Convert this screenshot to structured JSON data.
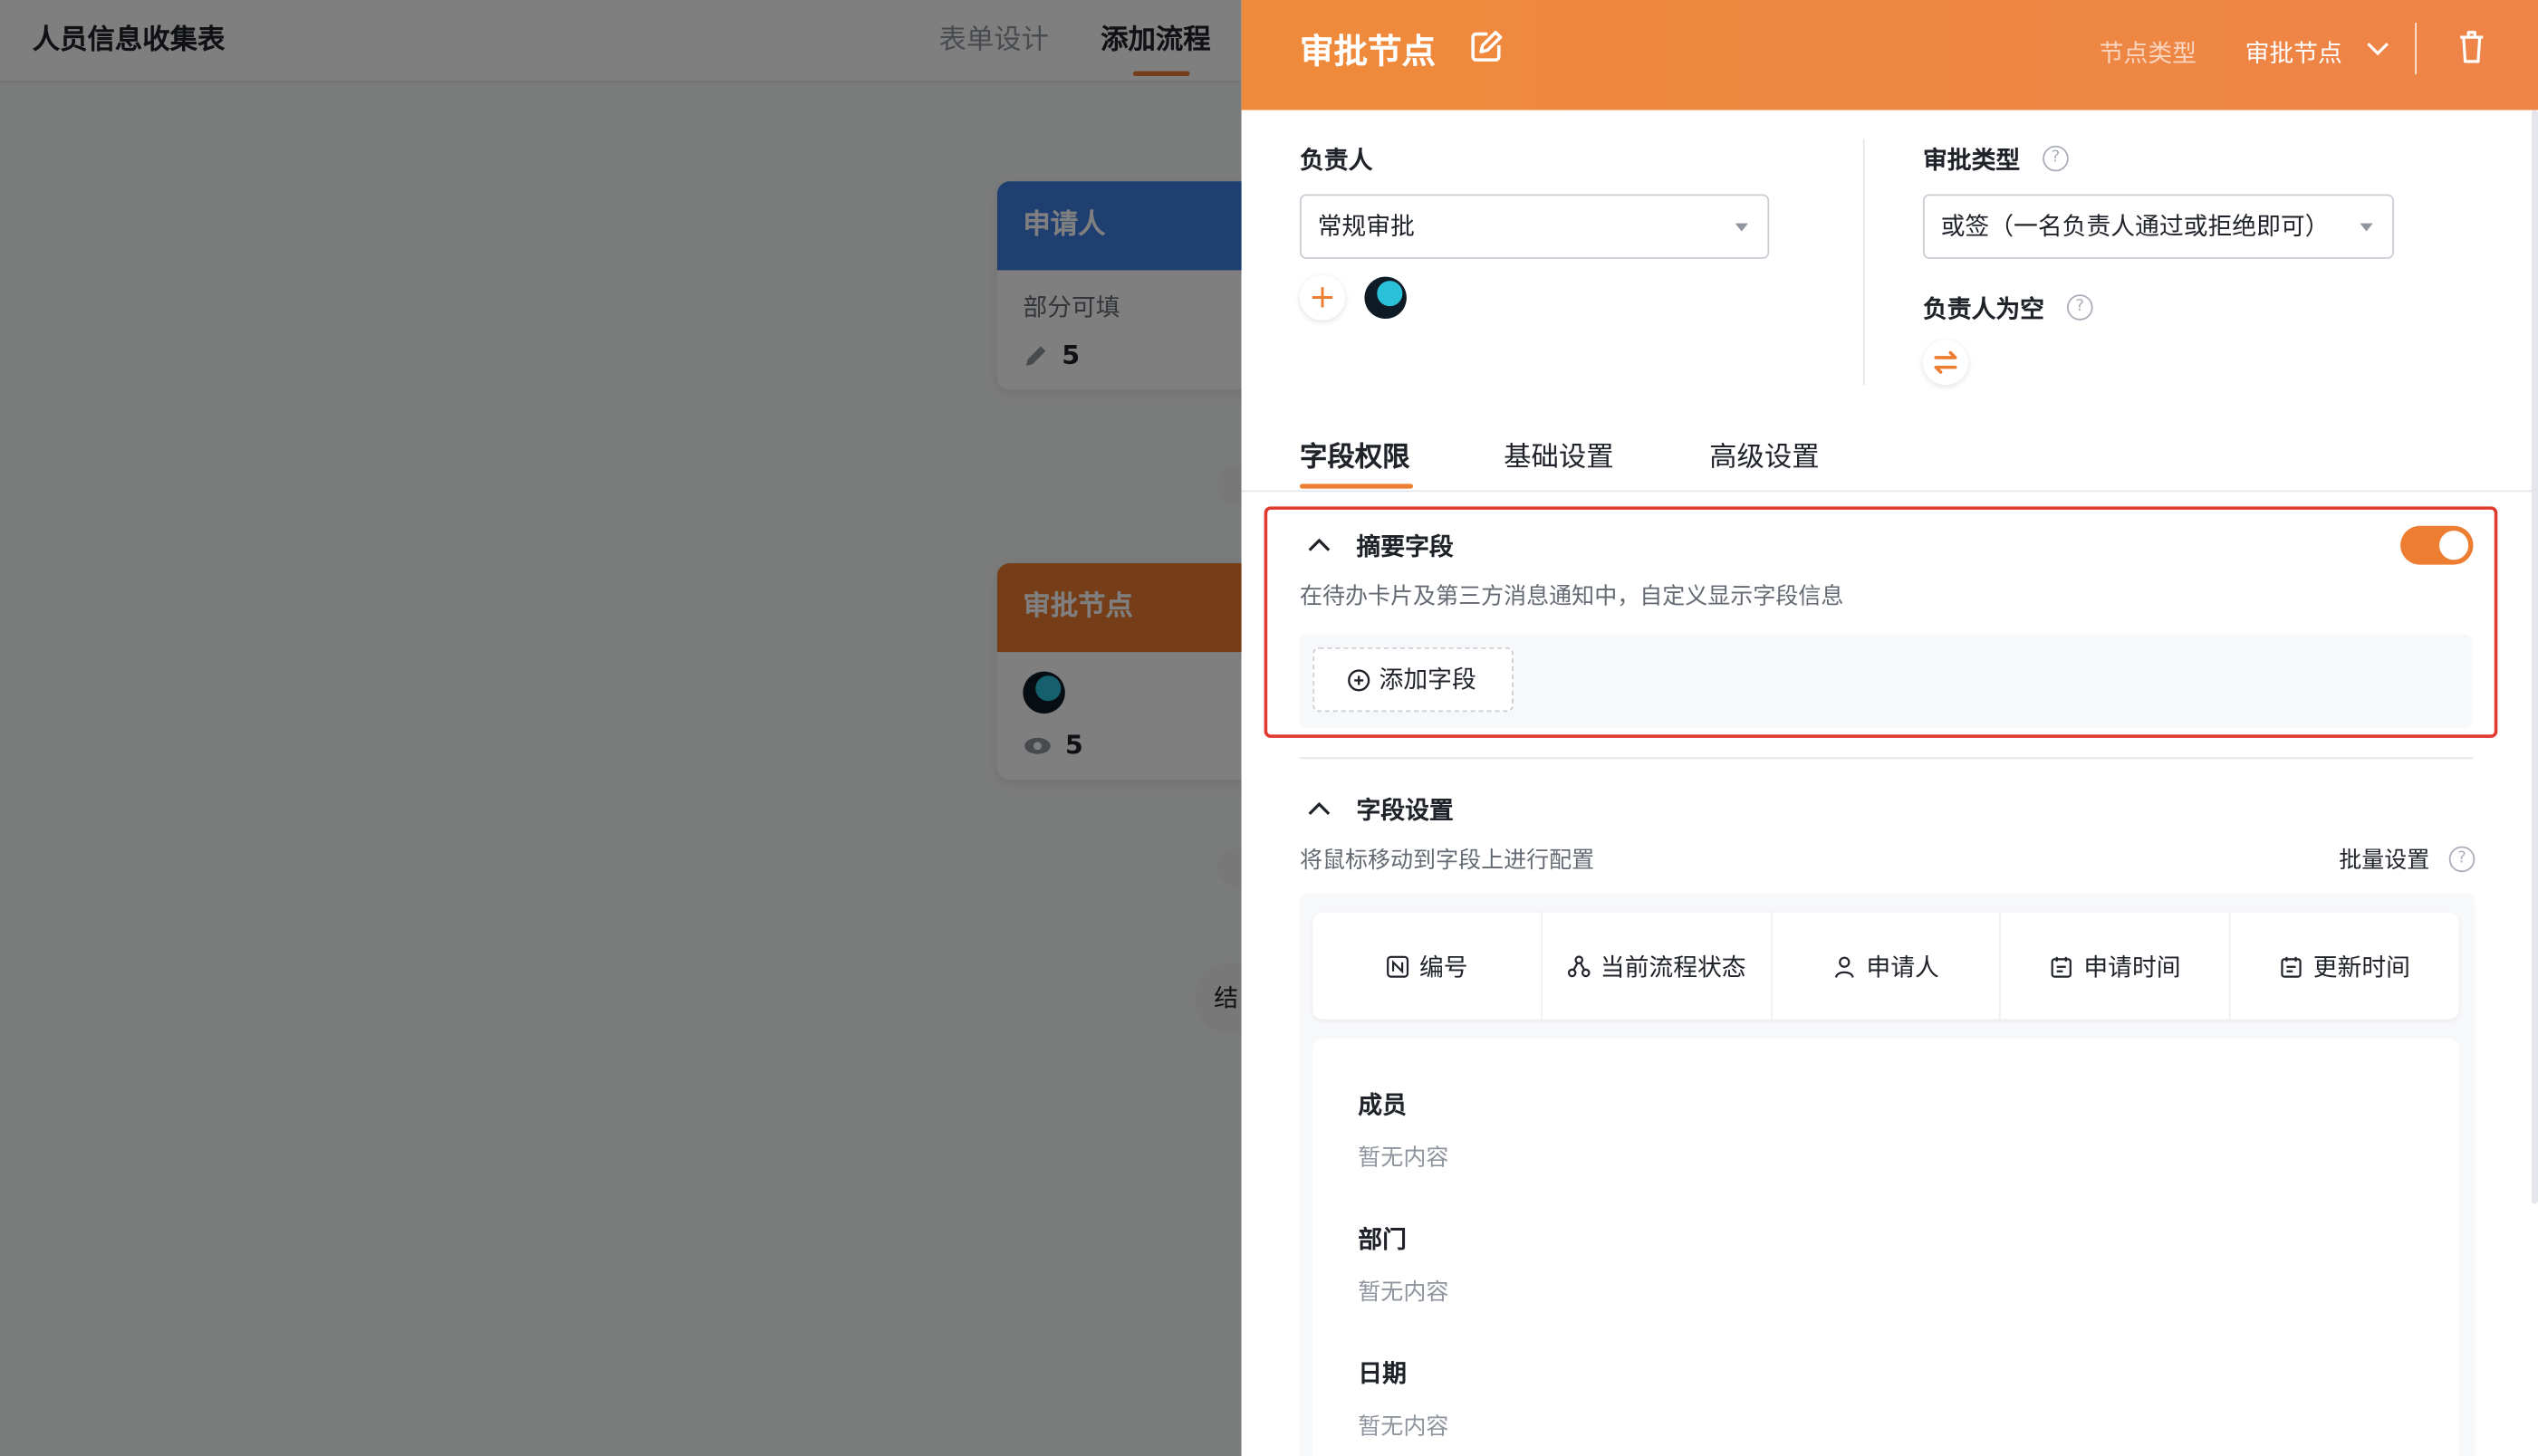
{
  "app": {
    "title": "人员信息收集表"
  },
  "nav": {
    "tabs": [
      {
        "label": "表单设计"
      },
      {
        "label": "添加流程"
      }
    ]
  },
  "flow": {
    "applicant": {
      "title": "申请人",
      "desc": "部分可填",
      "count": "5",
      "color": "#3f7fe0"
    },
    "approval": {
      "title": "审批节点",
      "count": "5",
      "color": "#ed7d31"
    },
    "end_label": "结"
  },
  "panel": {
    "title": "审批节点",
    "node_type_label": "节点类型",
    "node_type_value": "审批节点",
    "accent": "#ed7d31",
    "owner": {
      "label": "负责人",
      "select_value": "常规审批"
    },
    "approval_type": {
      "label": "审批类型",
      "select_value": "或签（一名负责人通过或拒绝即可）"
    },
    "empty_owner": {
      "label": "负责人为空"
    },
    "tabs": [
      {
        "label": "字段权限"
      },
      {
        "label": "基础设置"
      },
      {
        "label": "高级设置"
      }
    ],
    "summary": {
      "title": "摘要字段",
      "desc": "在待办卡片及第三方消息通知中，自定义显示字段信息",
      "enabled": true,
      "add_button": "添加字段"
    },
    "field_settings": {
      "title": "字段设置",
      "desc": "将鼠标移动到字段上进行配置",
      "bulk_label": "批量设置",
      "fields": [
        {
          "label": "编号",
          "icon": "number-icon"
        },
        {
          "label": "当前流程状态",
          "icon": "flow-status-icon"
        },
        {
          "label": "申请人",
          "icon": "user-icon"
        },
        {
          "label": "申请时间",
          "icon": "calendar-icon"
        },
        {
          "label": "更新时间",
          "icon": "calendar-icon"
        }
      ],
      "items": [
        {
          "title": "成员",
          "value": "暂无内容"
        },
        {
          "title": "部门",
          "value": "暂无内容"
        },
        {
          "title": "日期",
          "value": "暂无内容"
        }
      ]
    }
  }
}
